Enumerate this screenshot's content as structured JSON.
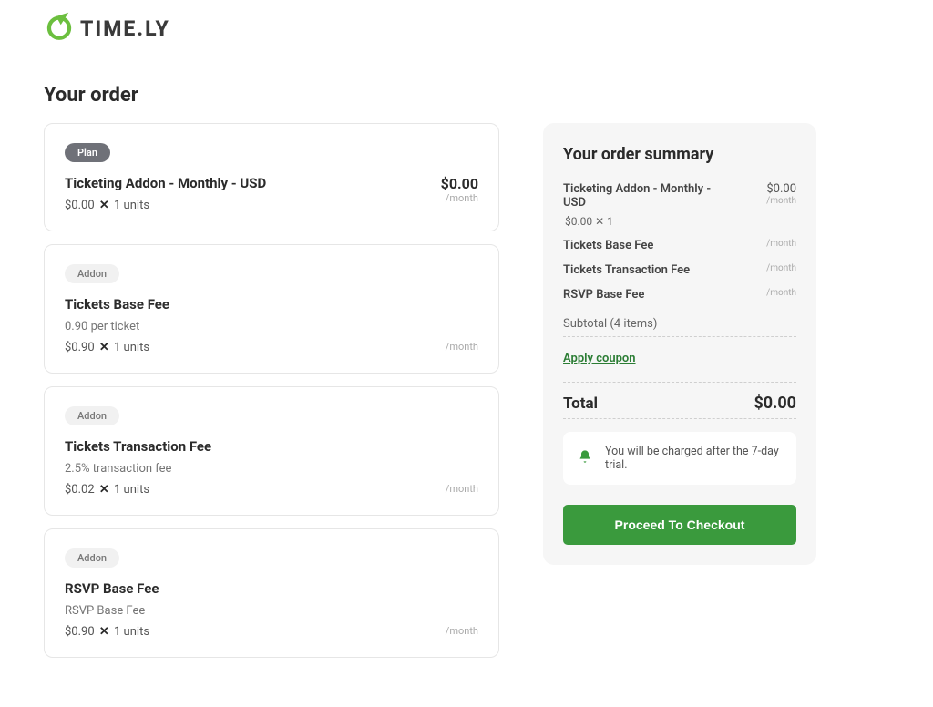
{
  "brand": {
    "name": "TIME.LY"
  },
  "page": {
    "title": "Your order"
  },
  "labels": {
    "plan_badge": "Plan",
    "addon_badge": "Addon",
    "period": "/month",
    "times": "✕"
  },
  "items": [
    {
      "type": "plan",
      "title": "Ticketing Addon - Monthly - USD",
      "desc": "",
      "unit_price": "$0.00",
      "units": "1 units",
      "price": "$0.00"
    },
    {
      "type": "addon",
      "title": "Tickets Base Fee",
      "desc": "0.90 per ticket",
      "unit_price": "$0.90",
      "units": "1 units",
      "price": ""
    },
    {
      "type": "addon",
      "title": "Tickets Transaction Fee",
      "desc": "2.5% transaction fee",
      "unit_price": "$0.02",
      "units": "1 units",
      "price": ""
    },
    {
      "type": "addon",
      "title": "RSVP Base Fee",
      "desc": "RSVP Base Fee",
      "unit_price": "$0.90",
      "units": "1 units",
      "price": ""
    }
  ],
  "summary": {
    "title": "Your order summary",
    "lines": [
      {
        "name": "Ticketing Addon - Monthly - USD",
        "price": "$0.00",
        "units": "$0.00 ✕ 1"
      },
      {
        "name": "Tickets Base Fee",
        "price": ""
      },
      {
        "name": "Tickets Transaction Fee",
        "price": ""
      },
      {
        "name": "RSVP Base Fee",
        "price": ""
      }
    ],
    "subtotal": "Subtotal (4 items)",
    "coupon": "Apply coupon",
    "total_label": "Total",
    "total_amount": "$0.00",
    "notice": "You will be charged after the 7-day trial.",
    "checkout": "Proceed To Checkout"
  }
}
